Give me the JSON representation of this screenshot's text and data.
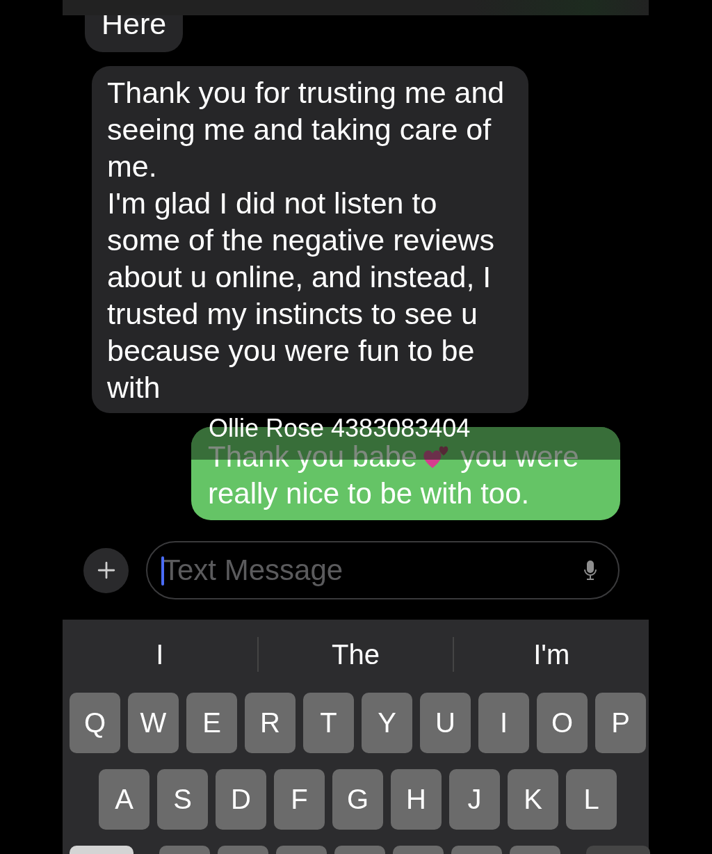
{
  "messages": [
    {
      "kind": "received",
      "text": "Here"
    },
    {
      "kind": "received",
      "text": "Thank you for trusting me and seeing me and taking care of me.\nI'm glad I did not listen to some of the negative reviews about u online, and instead, I trusted my instincts to see u because you were fun to be with"
    },
    {
      "kind": "sent",
      "text": "Thank you babe",
      "text_after_icon": "you were",
      "text_line_2": "really nice to be with too.",
      "caption": "Ollie Rose 4383083404"
    }
  ],
  "composer": {
    "placeholder": "Text Message"
  },
  "suggestions": [
    "I",
    "The",
    "I'm"
  ],
  "keyboard": {
    "rows": [
      [
        "Q",
        "W",
        "E",
        "R",
        "T",
        "Y",
        "U",
        "I",
        "O",
        "P"
      ],
      [
        "A",
        "S",
        "D",
        "F",
        "G",
        "H",
        "J",
        "K",
        "L"
      ]
    ]
  }
}
